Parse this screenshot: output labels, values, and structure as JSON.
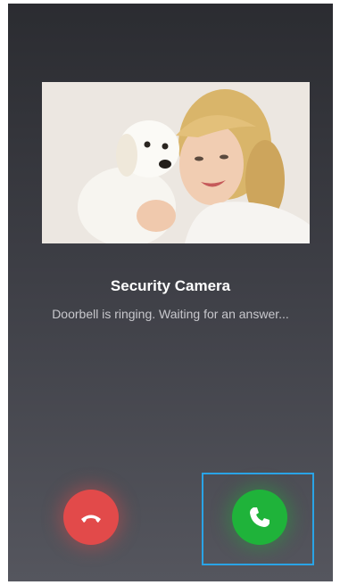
{
  "call": {
    "caller_name": "Security Camera",
    "status": "Doorbell is ringing. Waiting for an answer..."
  },
  "video_preview": {
    "description_icon": "camera-feed-image"
  },
  "actions": {
    "decline_icon": "hang-up-icon",
    "accept_icon": "phone-icon"
  },
  "colors": {
    "decline": "#e24a4a",
    "accept": "#1fb33a",
    "highlight": "#2aa4e6",
    "background_top": "#2b2c31",
    "background_bottom": "#55565e"
  }
}
